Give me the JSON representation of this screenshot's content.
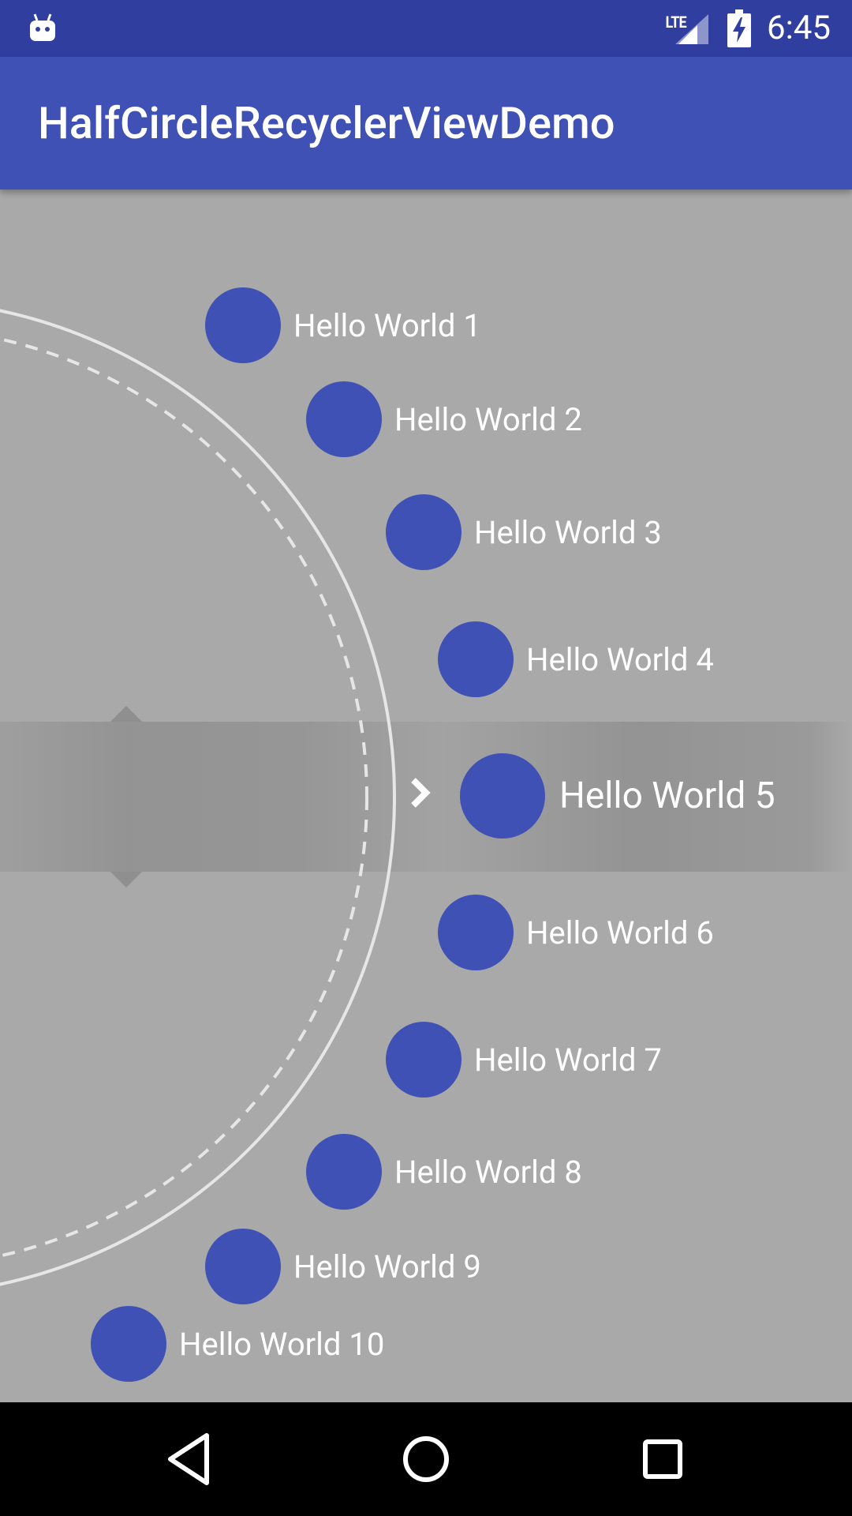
{
  "status_bar": {
    "network": "LTE",
    "time": "6:45",
    "icons": [
      "android-icon",
      "signal-icon",
      "battery-charging-icon"
    ]
  },
  "app_bar": {
    "title": "HalfCircleRecyclerViewDemo"
  },
  "list": {
    "items": [
      {
        "label": "Hello World 1"
      },
      {
        "label": "Hello World 2"
      },
      {
        "label": "Hello World 3"
      },
      {
        "label": "Hello World 4"
      },
      {
        "label": "Hello World 5"
      },
      {
        "label": "Hello World 6"
      },
      {
        "label": "Hello World 7"
      },
      {
        "label": "Hello World 8"
      },
      {
        "label": "Hello World 9"
      },
      {
        "label": "Hello World 10"
      }
    ],
    "selected_index": 4,
    "item_color": "#3f51b5",
    "background_color": "#a9a9a9"
  },
  "nav_bar": {
    "buttons": [
      "back-icon",
      "home-icon",
      "recents-icon"
    ]
  },
  "colors": {
    "status_bar": "#303f9f",
    "app_bar": "#3f51b5",
    "nav_bar": "#000000"
  }
}
